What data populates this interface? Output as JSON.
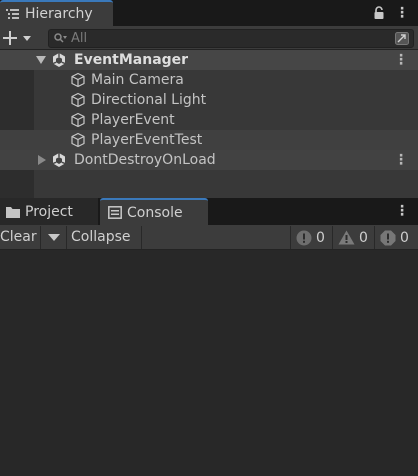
{
  "hierarchy": {
    "tab_label": "Hierarchy",
    "search_placeholder": "All",
    "scene": {
      "name": "EventManager"
    },
    "children": [
      {
        "label": "Main Camera"
      },
      {
        "label": "Directional Light"
      },
      {
        "label": "PlayerEvent"
      },
      {
        "label": "PlayerEventTest"
      }
    ],
    "dontdestroy": {
      "name": "DontDestroyOnLoad"
    }
  },
  "console": {
    "tabs": [
      {
        "label": "Project",
        "icon": "folder-icon"
      },
      {
        "label": "Console",
        "icon": "console-icon"
      }
    ],
    "toolbar": {
      "clear": "Clear",
      "collapse": "Collapse"
    },
    "counts": {
      "info": "0",
      "warning": "0",
      "error": "0"
    }
  },
  "colors": {
    "accent": "#3a79bb",
    "panel": "#383838",
    "console_bg": "#282828"
  }
}
